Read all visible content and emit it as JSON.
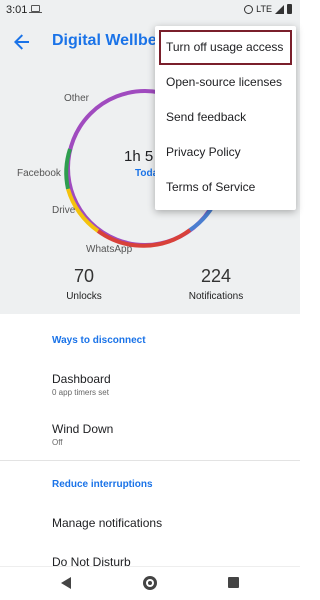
{
  "status_bar": {
    "time": "3:01",
    "network": "LTE"
  },
  "app_bar": {
    "title": "Digital Wellbeing"
  },
  "chart_data": {
    "type": "donut",
    "segments": [
      {
        "name": "Other",
        "color": "#a04bbf"
      },
      {
        "name": "Facebook",
        "color": "#2e9e4f"
      },
      {
        "name": "Drive",
        "color": "#f4c20d"
      },
      {
        "name": "WhatsApp",
        "color": "#d8413a"
      },
      {
        "name": "",
        "color": "#4a7fd0"
      }
    ],
    "center_value": "1h 5",
    "center_caption": "Toda"
  },
  "ring_labels": {
    "other": "Other",
    "facebook": "Facebook",
    "drive": "Drive",
    "whatsapp": "WhatsApp"
  },
  "stats": {
    "unlocks": {
      "value": "70",
      "label": "Unlocks"
    },
    "notifications": {
      "value": "224",
      "label": "Notifications"
    }
  },
  "ways_to_disconnect": {
    "heading": "Ways to disconnect",
    "dashboard": {
      "title": "Dashboard",
      "subtitle": "0 app timers set"
    },
    "wind_down": {
      "title": "Wind Down",
      "subtitle": "Off"
    }
  },
  "reduce_interruptions": {
    "heading": "Reduce interruptions",
    "manage_notifications": "Manage notifications",
    "do_not_disturb": "Do Not Disturb"
  },
  "overflow_menu": {
    "items": [
      "Turn off usage access",
      "Open-source licenses",
      "Send feedback",
      "Privacy Policy",
      "Terms of Service"
    ]
  }
}
